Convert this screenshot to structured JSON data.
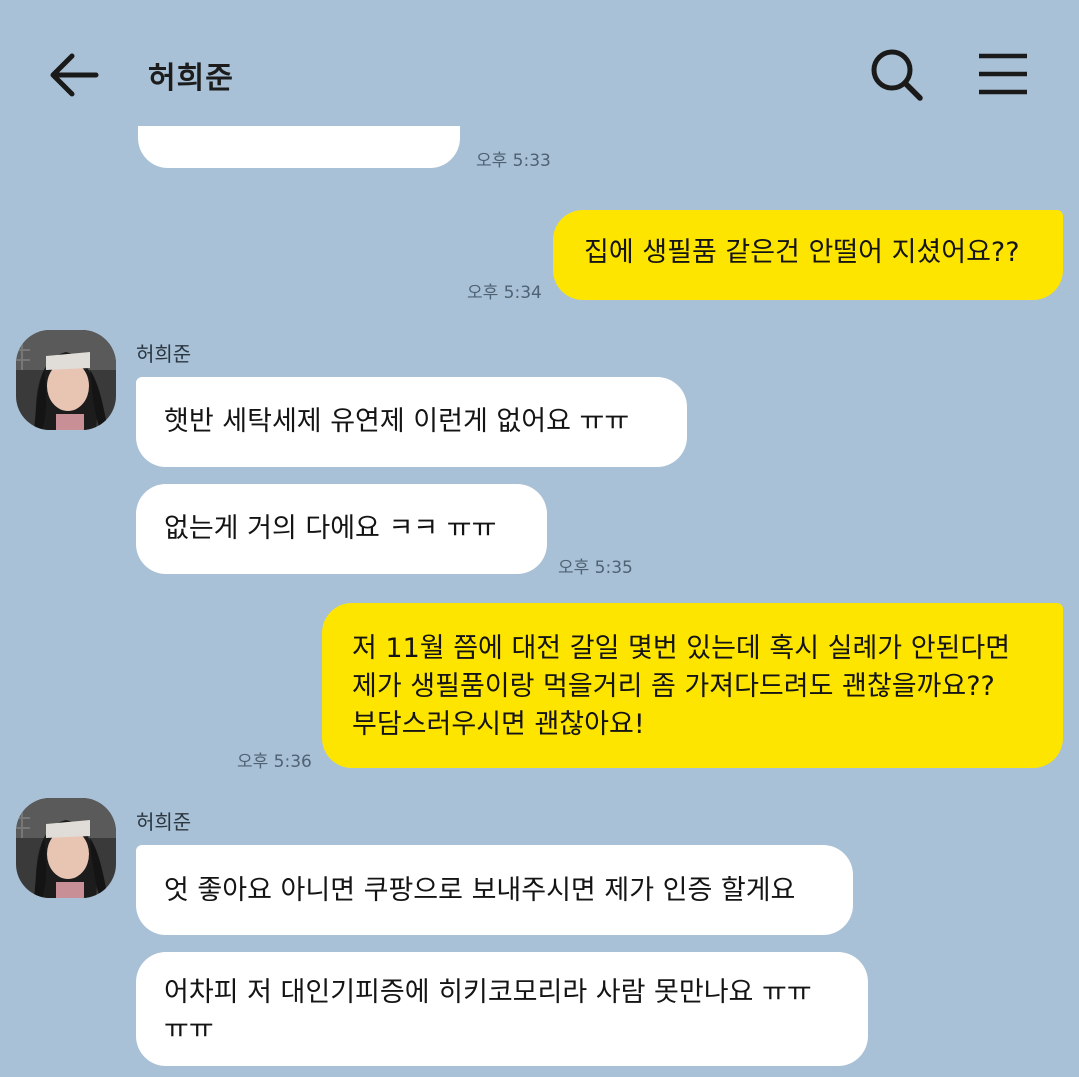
{
  "header": {
    "title": "허희준",
    "back_icon": "arrow-left-icon",
    "search_icon": "search-icon",
    "menu_icon": "hamburger-menu-icon"
  },
  "colors": {
    "background": "#a9c1d6",
    "incoming_bubble": "#ffffff",
    "outgoing_bubble": "#fee500"
  },
  "messages": [
    {
      "side": "in",
      "text": "",
      "time": "오후 5:33"
    },
    {
      "side": "out",
      "text": "집에 생필품 같은건 안떨어 지셨어요??",
      "time": "오후 5:34"
    },
    {
      "side": "in",
      "sender": "허희준",
      "text": "햇반 세탁세제 유연제 이런게 없어요 ㅠㅠ"
    },
    {
      "side": "in",
      "text": "없는게 거의 다에요 ㅋㅋ ㅠㅠ",
      "time": "오후 5:35"
    },
    {
      "side": "out",
      "lines": [
        "저 11월 쯤에 대전 갈일 몇번 있는데 혹시 실례가 안된다면",
        "제가 생필품이랑 먹을거리 좀 가져다드려도 괜찮을까요??",
        "부담스러우시면 괜찮아요!"
      ],
      "time": "오후 5:36"
    },
    {
      "side": "in",
      "sender": "허희준",
      "text": "엇 좋아요 아니면 쿠팡으로 보내주시면 제가 인증 할게요"
    },
    {
      "side": "in",
      "lines": [
        "어차피 저 대인기피증에 히키코모리라 사람 못만나요 ㅠㅠ",
        "ㅠㅠ"
      ]
    }
  ]
}
